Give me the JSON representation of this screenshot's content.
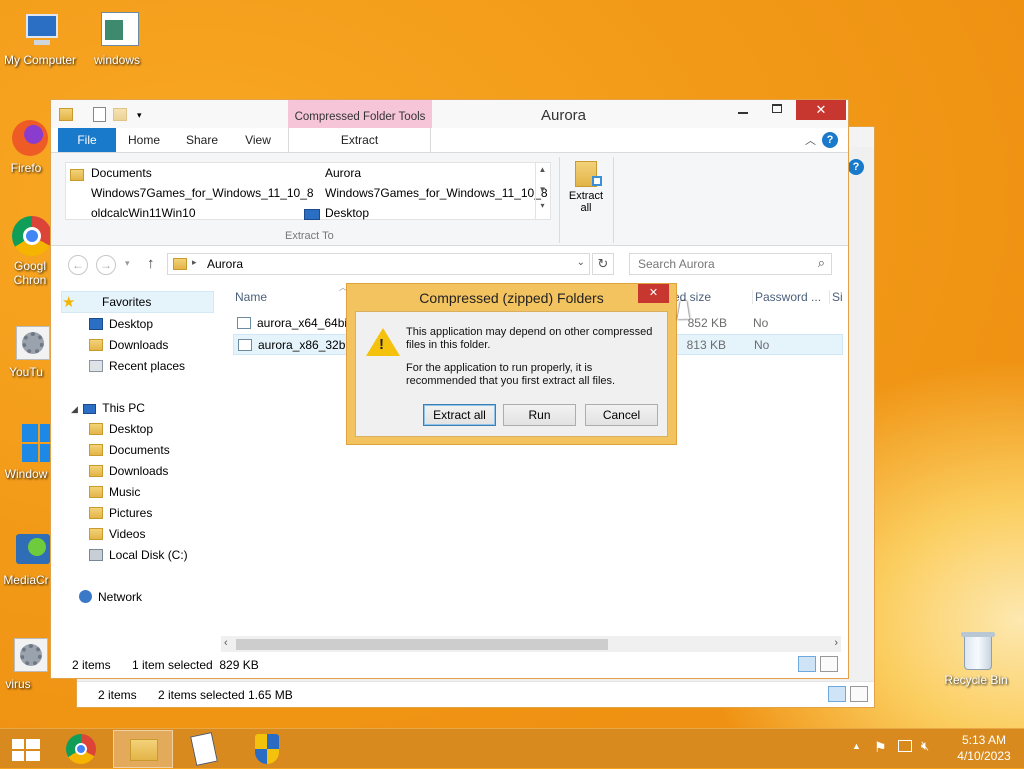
{
  "desktop": {
    "icons": [
      {
        "label": "My Computer",
        "icon": "computer-icon"
      },
      {
        "label": "windows",
        "icon": "document-icon"
      },
      {
        "label": "Firefo",
        "icon": "firefox-icon"
      },
      {
        "label": "Googl Chron",
        "icon": "chrome-icon"
      },
      {
        "label": "YouTu",
        "icon": "gear-shortcut-icon"
      },
      {
        "label": "Window",
        "icon": "windows-logo-icon"
      },
      {
        "label": "MediaCr",
        "icon": "media-creation-icon"
      },
      {
        "label": "virus",
        "icon": "gear-shortcut-icon"
      },
      {
        "label": "Recycle Bin",
        "icon": "recycle-bin-icon"
      }
    ]
  },
  "back_window": {
    "status": {
      "items": "2 items",
      "selected": "2 items selected 1.65 MB"
    }
  },
  "explorer": {
    "title": "Aurora",
    "context_tab": "Compressed Folder Tools",
    "tabs": [
      "File",
      "Home",
      "Share",
      "View",
      "Extract"
    ],
    "extract_to": {
      "group_label": "Extract To",
      "items": [
        [
          "Documents",
          "Aurora"
        ],
        [
          "Windows7Games_for_Windows_11_10_8",
          "Windows7Games_for_Windows_11_10_8"
        ],
        [
          "oldcalcWin11Win10",
          "Desktop"
        ]
      ]
    },
    "extract_all": {
      "line1": "Extract",
      "line2": "all"
    },
    "address": {
      "path": "Aurora"
    },
    "search": {
      "placeholder": "Search Aurora"
    },
    "columns": [
      "Name",
      "ed size",
      "Password ...",
      "Si"
    ],
    "files": [
      {
        "name": "aurora_x64_64bit",
        "size": "852 KB",
        "password": "No"
      },
      {
        "name": "aurora_x86_32bit",
        "size": "813 KB",
        "password": "No"
      }
    ],
    "nav": {
      "favorites": "Favorites",
      "fav_items": [
        "Desktop",
        "Downloads",
        "Recent places"
      ],
      "thispc": "This PC",
      "pc_items": [
        "Desktop",
        "Documents",
        "Downloads",
        "Music",
        "Pictures",
        "Videos",
        "Local Disk (C:)"
      ],
      "network": "Network"
    },
    "status": {
      "items": "2 items",
      "selected": "1 item selected  829 KB"
    }
  },
  "dialog": {
    "title": "Compressed (zipped) Folders",
    "message1": "This application may depend on other compressed files in this folder.",
    "message2": "For the application to run properly, it is recommended that you first extract all files.",
    "buttons": {
      "extract": "Extract all",
      "run": "Run",
      "cancel": "Cancel"
    }
  },
  "taskbar": {
    "time": "5:13 AM",
    "date": "4/10/2023"
  },
  "colors": {
    "accent": "#1979ca",
    "context_tab": "#f6c6d8",
    "dialog_frame": "#f3c35f",
    "close_red": "#c7372f"
  }
}
